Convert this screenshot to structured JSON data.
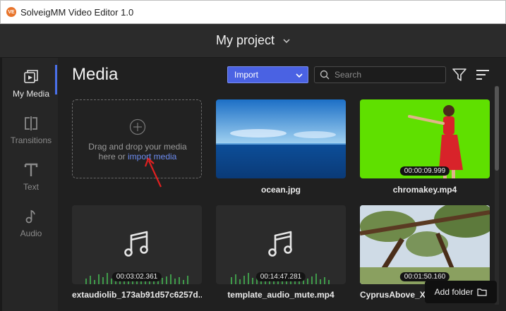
{
  "window": {
    "app_logo": "VE",
    "title": "SolveigMM Video Editor 1.0"
  },
  "header": {
    "project_title": "My project"
  },
  "sidebar": {
    "items": [
      {
        "label": "My Media",
        "icon": "my-media-icon",
        "active": true
      },
      {
        "label": "Transitions",
        "icon": "transitions-icon",
        "active": false
      },
      {
        "label": "Text",
        "icon": "text-icon",
        "active": false
      },
      {
        "label": "Audio",
        "icon": "audio-icon",
        "active": false
      }
    ]
  },
  "toolbar": {
    "title": "Media",
    "import_label": "Import",
    "search_placeholder": "Search",
    "accent": "#4a62e3"
  },
  "dropzone": {
    "line1": "Drag and drop your media",
    "line2_prefix": "here or ",
    "link": "import media"
  },
  "media": [
    {
      "name": "ocean.jpg",
      "duration": ""
    },
    {
      "name": "chromakey.mp4",
      "duration": "00:00:09.999"
    },
    {
      "name": "extaudiolib_173ab91d57c6257d...",
      "duration": "00:03:02.361"
    },
    {
      "name": "template_audio_mute.mp4",
      "duration": "00:14:47.281"
    },
    {
      "name": "CyprusAbove_XDCAM_HD422...",
      "duration": "00:01:50.160"
    }
  ],
  "add_folder_label": "Add folder",
  "colors": {
    "background": "#202020",
    "sidebar": "#262626",
    "chroma_green": "#5fe000",
    "link": "#6d8cf0"
  }
}
